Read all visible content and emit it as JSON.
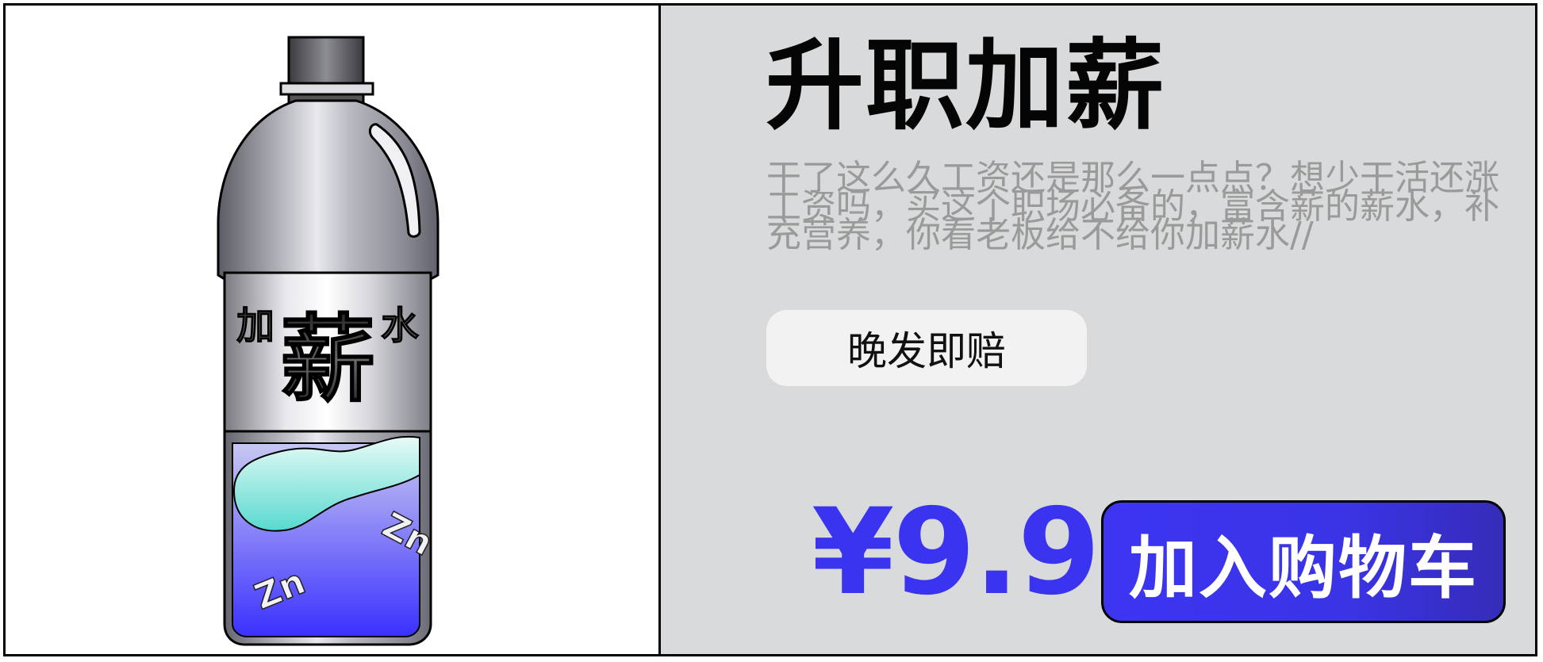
{
  "product": {
    "title": "升职加薪",
    "description": "干了这么久工资还是那么一点点？想少干活还涨工资吗，买这个职场必备的，富含薪的薪水，补充营养，你看老板给不给你加薪水//",
    "badge": "晚发即赔",
    "price": "¥9.9",
    "add_to_cart_label": "加入购物车"
  },
  "bottle_label": {
    "left_char": "加",
    "center_char": "薪",
    "right_char": "水",
    "element_1": "Zn",
    "element_2": "Zn"
  },
  "colors": {
    "accent": "#3a34f0",
    "panel_bg": "#d8dadb",
    "badge_bg": "#f2f2f2",
    "description_text": "#9a9a9a"
  },
  "icons": [
    "bottle-illustration"
  ]
}
